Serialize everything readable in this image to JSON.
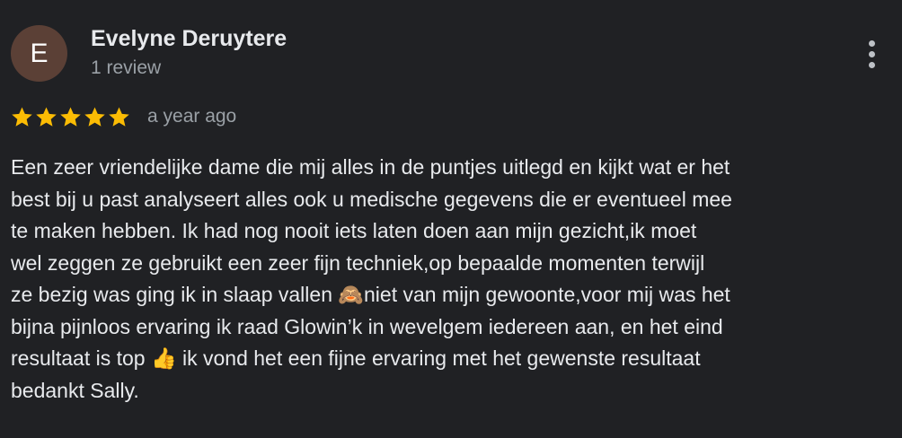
{
  "reviewer": {
    "avatar_letter": "E",
    "avatar_color": "#5b4036",
    "name": "Evelyne Deruytere",
    "review_count": "1 review"
  },
  "more_options_icon": "more-vert-icon",
  "rating": {
    "stars": 5,
    "max_stars": 5,
    "star_color": "#fbbc04",
    "icon": "star-icon"
  },
  "date": "a year ago",
  "review_lines": [
    "Een zeer vriendelijke dame die mij alles in de puntjes uitlegd en kijkt wat er het",
    "best bij u past analyseert alles ook u medische gegevens die er eventueel mee",
    "te maken hebben. Ik had nog nooit iets laten doen aan mijn gezicht,ik moet",
    "wel zeggen ze gebruikt een zeer fijn techniek,op bepaalde momenten terwijl",
    "ze bezig was ging ik in slaap vallen 🙈niet van mijn gewoonte,voor mij was het",
    "bijna pijnloos ervaring ik raad Glowin’k in wevelgem iedereen aan, en het eind",
    "resultaat is top 👍 ik vond het een fijne ervaring met het gewenste resultaat",
    "bedankt Sally."
  ]
}
